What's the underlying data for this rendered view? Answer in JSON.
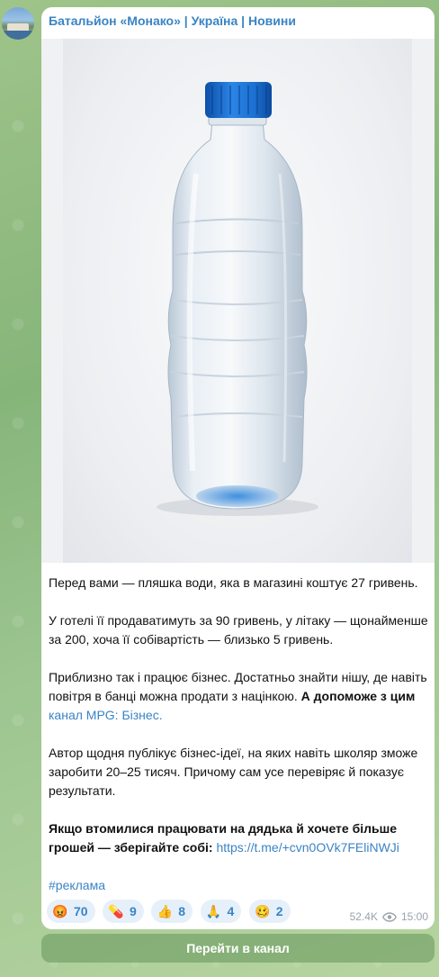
{
  "channel": {
    "title": "Батальйон «Монако» | Україна | Новини"
  },
  "post": {
    "paragraph1": "Перед вами — пляшка води, яка в магазині коштує 27 гривень.",
    "paragraph2": "У готелі її продаватимуть за 90 гривень, у літаку — щонайменше за 200, хоча її собівартість — близько 5 гривень.",
    "paragraph3_text": "Приблизно так і працює бізнес. Достатньо знайти нішу, де навіть повітря в банці можна продати з націнкою. ",
    "paragraph3_bold": "А допоможе з цим",
    "paragraph3_link": "канал MPG: Бізнес.",
    "paragraph4": "Автор щодня публікує бізнес-ідеї, на яких навіть школяр зможе заробити 20–25 тисяч. Причому сам усе перевіряє й показує результати.",
    "paragraph5_bold": "Якщо втомилися працювати на дядька й хочете більше грошей — зберігайте собі:",
    "paragraph5_link": "https://t.me/+cvn0OVk7FEliNWJi",
    "hashtag": "#реклама"
  },
  "reactions": [
    {
      "icon": "angry-face-icon",
      "emoji": "😡",
      "count": "70"
    },
    {
      "icon": "pill-icon",
      "emoji": "💊",
      "count": "9"
    },
    {
      "icon": "thumbs-up-icon",
      "emoji": "👍",
      "count": "8"
    },
    {
      "icon": "folded-hands-icon",
      "emoji": "🙏",
      "count": "4"
    },
    {
      "icon": "woozy-face-icon",
      "emoji": "🥴",
      "count": "2"
    }
  ],
  "meta": {
    "views": "52.4K",
    "time": "15:00"
  },
  "button": {
    "label": "Перейти в канал"
  },
  "colors": {
    "link": "#3a84c4",
    "bottle_cap": "#1a6fd0"
  }
}
